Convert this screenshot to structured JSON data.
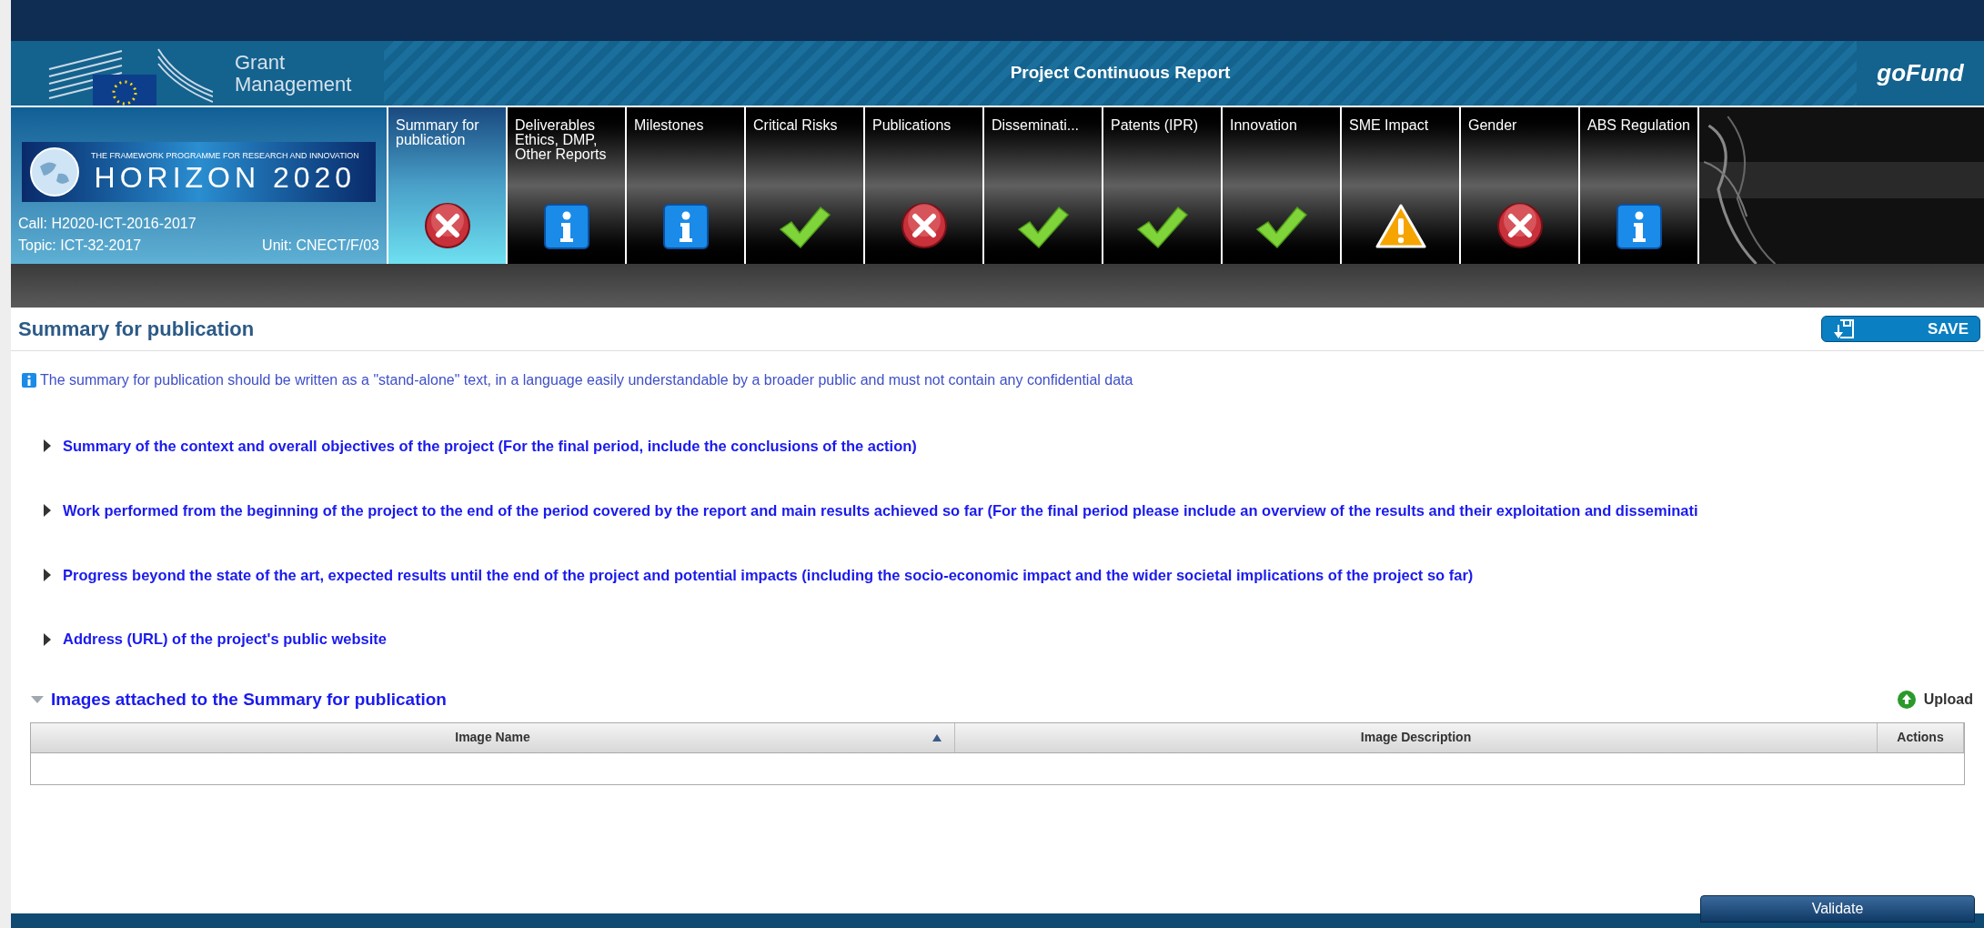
{
  "header": {
    "brand": [
      "Grant",
      "Management"
    ],
    "title": "Project Continuous Report",
    "logo": "goFund"
  },
  "project": {
    "banner_small": "THE FRAMEWORK PROGRAMME FOR RESEARCH AND INNOVATION",
    "banner": "HORIZON 2020",
    "call": "Call: H2020-ICT-2016-2017",
    "topic": "Topic: ICT-32-2017",
    "unit": "Unit: CNECT/F/03"
  },
  "tabs": [
    {
      "label": "Summary for publication",
      "kind": "error",
      "selected": true
    },
    {
      "label": "Deliverables Ethics, DMP, Other Reports",
      "kind": "info",
      "selected": false
    },
    {
      "label": "Milestones",
      "kind": "info",
      "selected": false
    },
    {
      "label": "Critical Risks",
      "kind": "ok",
      "selected": false
    },
    {
      "label": "Publications",
      "kind": "error",
      "selected": false
    },
    {
      "label": "Disseminati...",
      "kind": "ok",
      "selected": false
    },
    {
      "label": "Patents (IPR)",
      "kind": "ok",
      "selected": false
    },
    {
      "label": "Innovation",
      "kind": "ok",
      "selected": false
    },
    {
      "label": "SME Impact",
      "kind": "warning",
      "selected": false
    },
    {
      "label": "Gender",
      "kind": "error",
      "selected": false
    },
    {
      "label": "ABS Regulation",
      "kind": "info",
      "selected": false
    }
  ],
  "page": {
    "title": "Summary for publication",
    "save": "SAVE",
    "info": "The summary for publication should be written as a \"stand-alone\" text, in a language easily understandable by a broader public and must not contain any confidential data"
  },
  "sections": [
    {
      "label": "Summary of the context and overall objectives of the project (For the final period, include the conclusions of the action)",
      "expanded": false
    },
    {
      "label": "Work performed from the beginning of the project to the end of the period covered by the report and main results achieved so far (For the final period please include an overview of the results and their exploitation and disseminati",
      "expanded": false
    },
    {
      "label": "Progress beyond the state of the art, expected results until the end of the project and potential impacts (including the socio-economic impact and the wider societal implications of the project so far)",
      "expanded": false
    },
    {
      "label": "Address (URL) of the project's public website",
      "expanded": false
    }
  ],
  "images": {
    "label": "Images attached to the Summary for publication",
    "expanded": true,
    "upload": "Upload",
    "columns": [
      {
        "label": "Image Name",
        "sorted": true
      },
      {
        "label": "Image Description",
        "sorted": false
      },
      {
        "label": "Actions",
        "sorted": false
      }
    ]
  },
  "footer": {
    "validate": "Validate"
  }
}
